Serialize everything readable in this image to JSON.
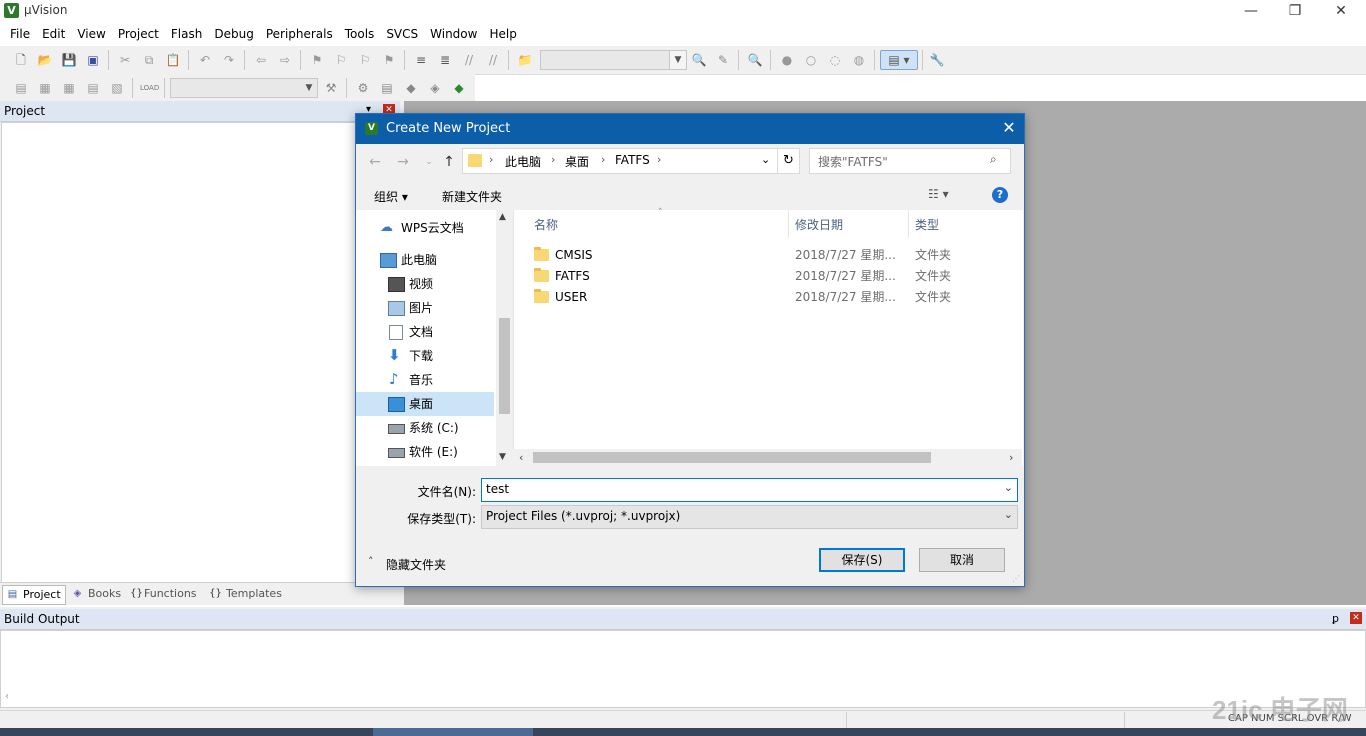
{
  "window": {
    "title": "µVision",
    "minimize": "—",
    "restore": "❐",
    "close": "✕"
  },
  "menu": [
    "File",
    "Edit",
    "View",
    "Project",
    "Flash",
    "Debug",
    "Peripherals",
    "Tools",
    "SVCS",
    "Window",
    "Help"
  ],
  "toolbar2": {
    "target_value": ""
  },
  "project_pane": {
    "header": "Project",
    "pin": "▾",
    "close": "✕",
    "tabs": [
      {
        "label": "Project",
        "icon": "project-icon"
      },
      {
        "label": "Books",
        "icon": "books-icon"
      },
      {
        "label": "Functions",
        "icon": "functions-icon"
      },
      {
        "label": "Templates",
        "icon": "templates-icon"
      }
    ]
  },
  "build_output": {
    "header": "Build Output",
    "pin": "ꝑ",
    "close": "✕"
  },
  "statusbar": {
    "right_text": "CAP NUM SCRL OVR R/W"
  },
  "watermark": {
    "text": "21ic 电子网"
  },
  "dialog": {
    "title": "Create New Project",
    "close": "✕",
    "breadcrumb": [
      "此电脑",
      "桌面",
      "FATFS"
    ],
    "search_placeholder": "搜索\"FATFS\"",
    "cmd_organize": "组织 ▾",
    "cmd_new_folder": "新建文件夹",
    "help": "?",
    "nav_items": [
      {
        "label": "WPS云文档",
        "icon": "cloud-icon",
        "indent": 1
      },
      {
        "label": "此电脑",
        "icon": "computer-icon",
        "indent": 1
      },
      {
        "label": "视频",
        "icon": "video-icon",
        "indent": 2
      },
      {
        "label": "图片",
        "icon": "picture-icon",
        "indent": 2
      },
      {
        "label": "文档",
        "icon": "document-icon",
        "indent": 2
      },
      {
        "label": "下载",
        "icon": "download-icon",
        "indent": 2
      },
      {
        "label": "音乐",
        "icon": "music-icon",
        "indent": 2
      },
      {
        "label": "桌面",
        "icon": "desktop-icon",
        "indent": 2,
        "selected": true
      },
      {
        "label": "系统 (C:)",
        "icon": "drive-c-icon",
        "indent": 2
      },
      {
        "label": "软件 (E:)",
        "icon": "drive-e-icon",
        "indent": 2
      }
    ],
    "columns": {
      "name": "名称",
      "date": "修改日期",
      "type": "类型"
    },
    "files": [
      {
        "name": "CMSIS",
        "date": "2018/7/27 星期...",
        "type": "文件夹"
      },
      {
        "name": "FATFS",
        "date": "2018/7/27 星期...",
        "type": "文件夹"
      },
      {
        "name": "USER",
        "date": "2018/7/27 星期...",
        "type": "文件夹"
      }
    ],
    "filename_label": "文件名(N):",
    "filename_value": "test",
    "filetype_label": "保存类型(T):",
    "filetype_value": "Project Files (*.uvproj; *.uvprojx)",
    "hide_folders": "隐藏文件夹",
    "save": "保存(S)",
    "cancel": "取消"
  }
}
